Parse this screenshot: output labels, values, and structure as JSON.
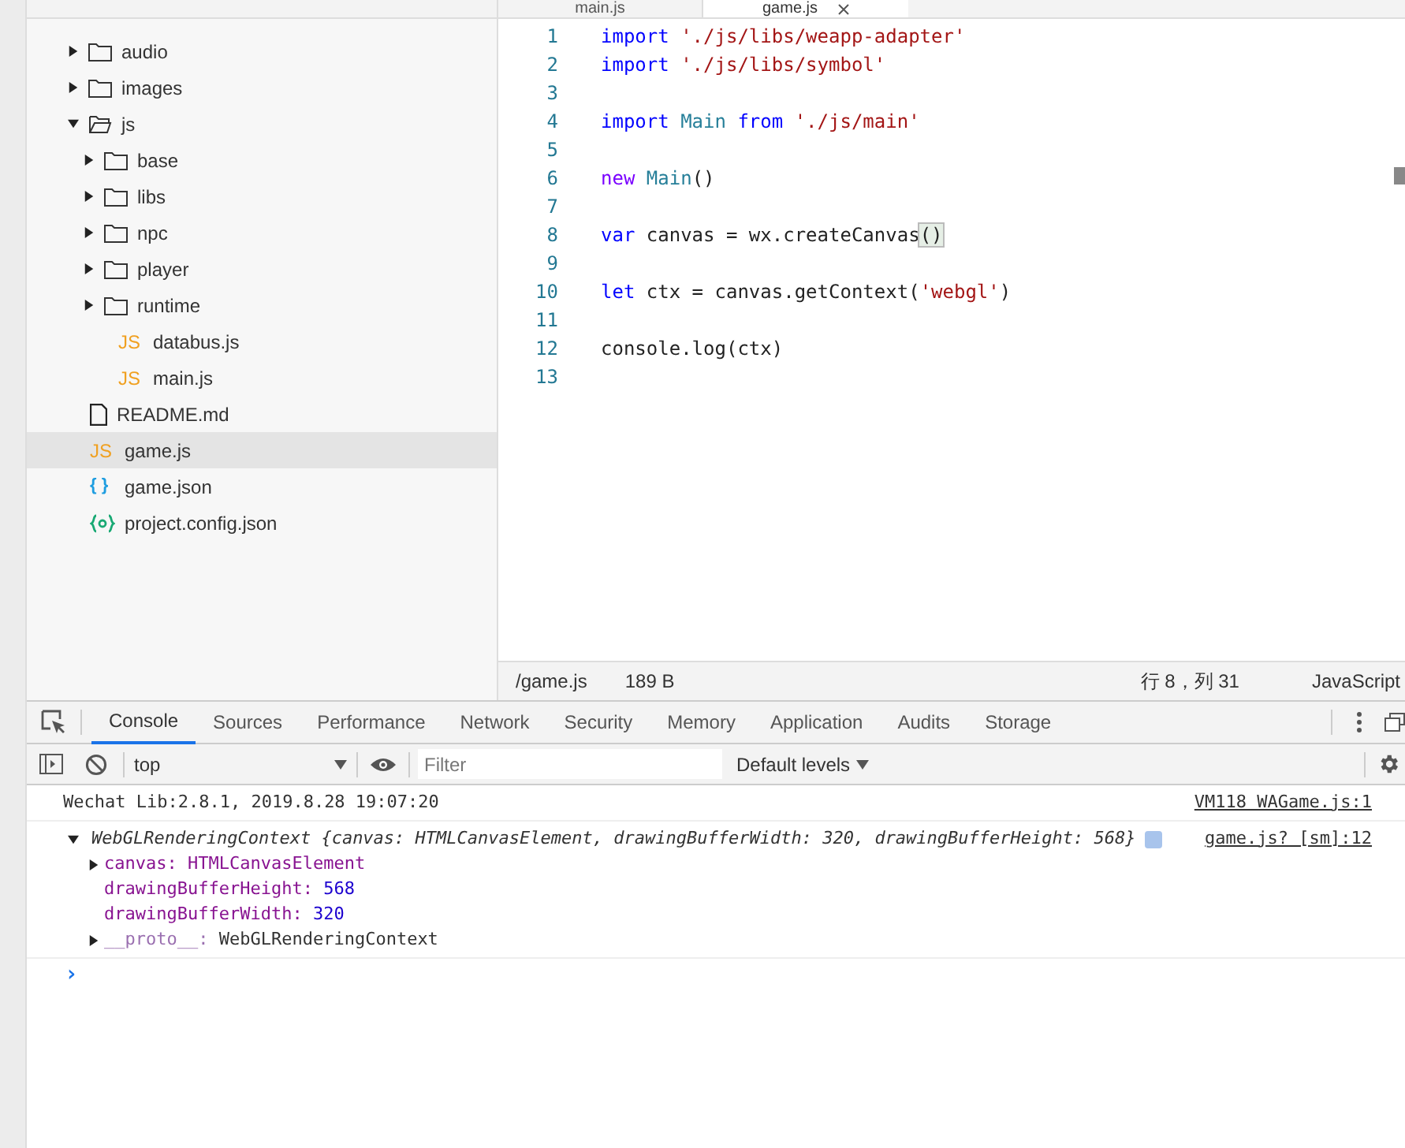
{
  "editor_tabs": [
    {
      "label": "main.js",
      "selected": false
    },
    {
      "label": "game.js",
      "selected": true
    }
  ],
  "file_tree": [
    {
      "name": "audio",
      "kind": "folder",
      "expanded": false,
      "selected": false
    },
    {
      "name": "images",
      "kind": "folder",
      "expanded": false,
      "selected": false
    },
    {
      "name": "js",
      "kind": "folder",
      "expanded": true,
      "selected": false,
      "children": [
        {
          "name": "base",
          "kind": "folder",
          "expanded": false,
          "selected": false
        },
        {
          "name": "libs",
          "kind": "folder",
          "expanded": false,
          "selected": false
        },
        {
          "name": "npc",
          "kind": "folder",
          "expanded": false,
          "selected": false
        },
        {
          "name": "player",
          "kind": "folder",
          "expanded": false,
          "selected": false
        },
        {
          "name": "runtime",
          "kind": "folder",
          "expanded": false,
          "selected": false
        },
        {
          "name": "databus.js",
          "kind": "js",
          "icon_text": "JS",
          "selected": false
        },
        {
          "name": "main.js",
          "kind": "js",
          "icon_text": "JS",
          "selected": false
        }
      ]
    },
    {
      "name": "README.md",
      "kind": "file",
      "selected": false
    },
    {
      "name": "game.js",
      "kind": "js",
      "icon_text": "JS",
      "selected": true
    },
    {
      "name": "game.json",
      "kind": "json",
      "icon_text": "{ }",
      "selected": false
    },
    {
      "name": "project.config.json",
      "kind": "config",
      "selected": false
    }
  ],
  "code_lines": [
    {
      "number": "1",
      "tokens": [
        {
          "text": "import",
          "kind": "keyword"
        },
        {
          "text": " './js/libs/weapp-adapter'",
          "kind": "string"
        }
      ]
    },
    {
      "number": "2",
      "tokens": [
        {
          "text": "import",
          "kind": "keyword"
        },
        {
          "text": " './js/libs/symbol'",
          "kind": "string"
        }
      ]
    },
    {
      "number": "3"
    },
    {
      "number": "4",
      "tokens": [
        {
          "text": "import",
          "kind": "keyword"
        },
        {
          "text": " Main",
          "kind": "class"
        },
        {
          "text": " from",
          "kind": "keyword"
        },
        {
          "text": " './js/main'",
          "kind": "string"
        }
      ]
    },
    {
      "number": "5"
    },
    {
      "number": "6",
      "tokens": [
        {
          "text": "new",
          "kind": "new"
        },
        {
          "text": " Main",
          "kind": "class"
        },
        {
          "text": "()",
          "kind": "plain"
        }
      ]
    },
    {
      "number": "7"
    },
    {
      "number": "8",
      "tokens": [
        {
          "text": "var",
          "kind": "keyword"
        },
        {
          "text": " canvas = wx.createCanvas",
          "kind": "plain"
        },
        {
          "text": "()",
          "kind": "match"
        }
      ]
    },
    {
      "number": "9"
    },
    {
      "number": "10",
      "tokens": [
        {
          "text": "let",
          "kind": "keyword"
        },
        {
          "text": " ctx = canvas.getContext(",
          "kind": "plain"
        },
        {
          "text": "'webgl'",
          "kind": "string"
        },
        {
          "text": ")",
          "kind": "plain"
        }
      ]
    },
    {
      "number": "11"
    },
    {
      "number": "12",
      "tokens": [
        {
          "text": "console.log(ctx)",
          "kind": "plain"
        }
      ]
    },
    {
      "number": "13"
    }
  ],
  "editor_status": {
    "path": "/game.js",
    "size": "189 B",
    "cursor": "行 8，列 31",
    "language": "JavaScript"
  },
  "devtools_tabs": [
    {
      "label": "Console",
      "selected": true
    },
    {
      "label": "Sources",
      "selected": false
    },
    {
      "label": "Performance",
      "selected": false
    },
    {
      "label": "Network",
      "selected": false
    },
    {
      "label": "Security",
      "selected": false
    },
    {
      "label": "Memory",
      "selected": false
    },
    {
      "label": "Application",
      "selected": false
    },
    {
      "label": "Audits",
      "selected": false
    },
    {
      "label": "Storage",
      "selected": false
    }
  ],
  "console_toolbar": {
    "context": "top",
    "filter_placeholder": "Filter",
    "levels": "Default levels"
  },
  "console_messages": [
    {
      "kind": "log",
      "text": "Wechat Lib:2.8.1, 2019.8.28 19:07:20",
      "source": "VM118 WAGame.js:1"
    },
    {
      "kind": "object",
      "summary": "WebGLRenderingContext {canvas: HTMLCanvasElement, drawingBufferWidth: 320, drawingBufferHeight: 568}",
      "source": "game.js? [sm]:12",
      "expanded": true,
      "properties": [
        {
          "key": "canvas:",
          "value": "HTMLCanvasElement",
          "expandable": true,
          "kind": "prop"
        },
        {
          "key": "drawingBufferHeight:",
          "value": "568",
          "expandable": false,
          "kind": "prop"
        },
        {
          "key": "drawingBufferWidth:",
          "value": "320",
          "expandable": false,
          "kind": "prop"
        },
        {
          "key": "__proto__:",
          "value": "WebGLRenderingContext",
          "expandable": true,
          "kind": "proto"
        }
      ]
    }
  ],
  "prompt": "›"
}
